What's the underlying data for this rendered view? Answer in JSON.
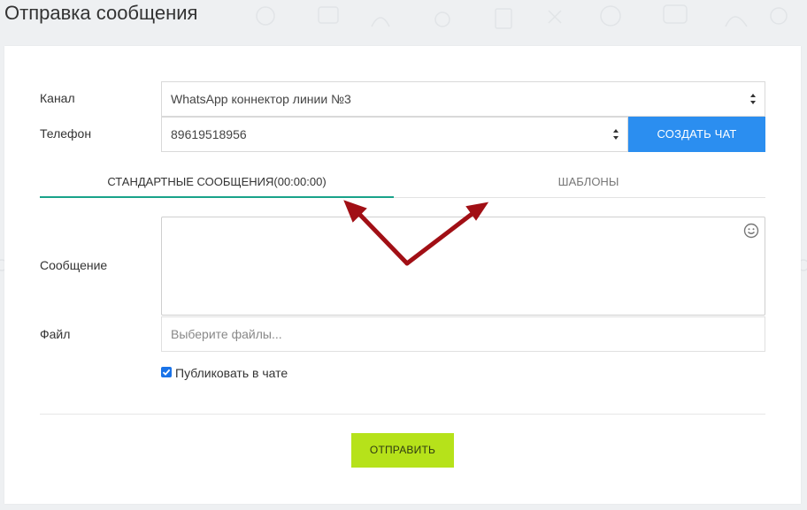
{
  "page": {
    "title": "Отправка сообщения"
  },
  "form": {
    "channel": {
      "label": "Канал",
      "value": "WhatsApp коннектор линии №3"
    },
    "phone": {
      "label": "Телефон",
      "value": "89619518956"
    },
    "create_chat_label": "СОЗДАТЬ ЧАТ",
    "tabs": [
      {
        "label": "СТАНДАРТНЫЕ СООБЩЕНИЯ(00:00:00)",
        "active": true
      },
      {
        "label": "ШАБЛОНЫ",
        "active": false
      }
    ],
    "message": {
      "label": "Сообщение",
      "value": ""
    },
    "file": {
      "label": "Файл",
      "placeholder": "Выберите файлы..."
    },
    "publish": {
      "label": "Публиковать в чате",
      "checked": true
    },
    "send_label": "ОТПРАВИТЬ"
  },
  "colors": {
    "primary_button": "#2b8ef0",
    "send_button": "#b6e21a",
    "active_tab_underline": "#19a38a",
    "annotation_arrows": "#a10f15"
  },
  "icons": {
    "message_emoji": "smiley-icon",
    "select_spinners": "updown-spinner-icon"
  }
}
